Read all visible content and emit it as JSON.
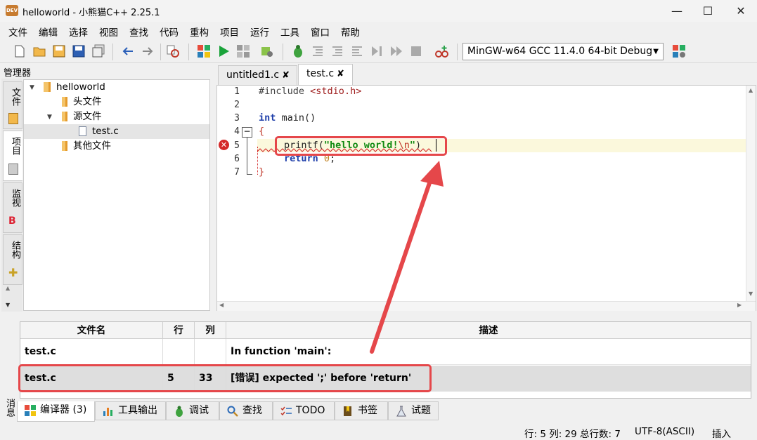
{
  "window": {
    "title": "helloworld - 小熊猫C++ 2.25.1",
    "app_icon_text": "DEV"
  },
  "menu": [
    "文件",
    "编辑",
    "选择",
    "视图",
    "查找",
    "代码",
    "重构",
    "项目",
    "运行",
    "工具",
    "窗口",
    "帮助"
  ],
  "toolbar": {
    "compiler": "MinGW-w64 GCC 11.4.0 64-bit Debug"
  },
  "manager": {
    "title": "管理器",
    "side_tabs": [
      "文件",
      "项目",
      "监视",
      "结构"
    ],
    "tree": [
      {
        "label": "helloworld"
      },
      {
        "label": "头文件"
      },
      {
        "label": "源文件"
      },
      {
        "label": "test.c"
      },
      {
        "label": "其他文件"
      }
    ]
  },
  "editor": {
    "tabs": [
      {
        "label": "untitled1.c"
      },
      {
        "label": "test.c"
      }
    ],
    "close_glyph": "✘",
    "lines": [
      {
        "num": "1",
        "text": "#include <stdio.h>"
      },
      {
        "num": "2",
        "text": ""
      },
      {
        "num": "3",
        "text": "int main()"
      },
      {
        "num": "4",
        "text": "{"
      },
      {
        "num": "5",
        "text": "    printf(\"hello world!\\n\")"
      },
      {
        "num": "6",
        "text": "    return 0;"
      },
      {
        "num": "7",
        "text": "}"
      }
    ],
    "code_parts": {
      "include": "#include",
      "header": "<stdio.h>",
      "int_kw": "int",
      "main_sig": " main()",
      "lbrace": "{",
      "printf": "printf(",
      "str": "\"hello world!",
      "esc": "\\n",
      "strend": "\"",
      "rparen": ")",
      "return_kw": "return",
      "zero": "0",
      "semi": ";",
      "rbrace": "}"
    }
  },
  "messages": {
    "side_label": "消息",
    "columns": [
      "文件名",
      "行",
      "列",
      "描述"
    ],
    "rows": [
      {
        "file": "test.c",
        "line": "",
        "col": "",
        "desc": "In function 'main':"
      },
      {
        "file": "test.c",
        "line": "5",
        "col": "33",
        "desc": "[错误] expected ';' before 'return'"
      }
    ],
    "tabs": [
      "编译器 (3)",
      "工具输出",
      "调试",
      "查找",
      "TODO",
      "书签",
      "试题"
    ]
  },
  "status": {
    "position": "行: 5 列: 29 总行数: 7",
    "encoding": "UTF-8(ASCII)",
    "mode": "插入"
  },
  "colors": {
    "annotation": "#e5474a",
    "keyword": "#1f3faa",
    "string": "#128a12",
    "error": "#d42a2a"
  }
}
